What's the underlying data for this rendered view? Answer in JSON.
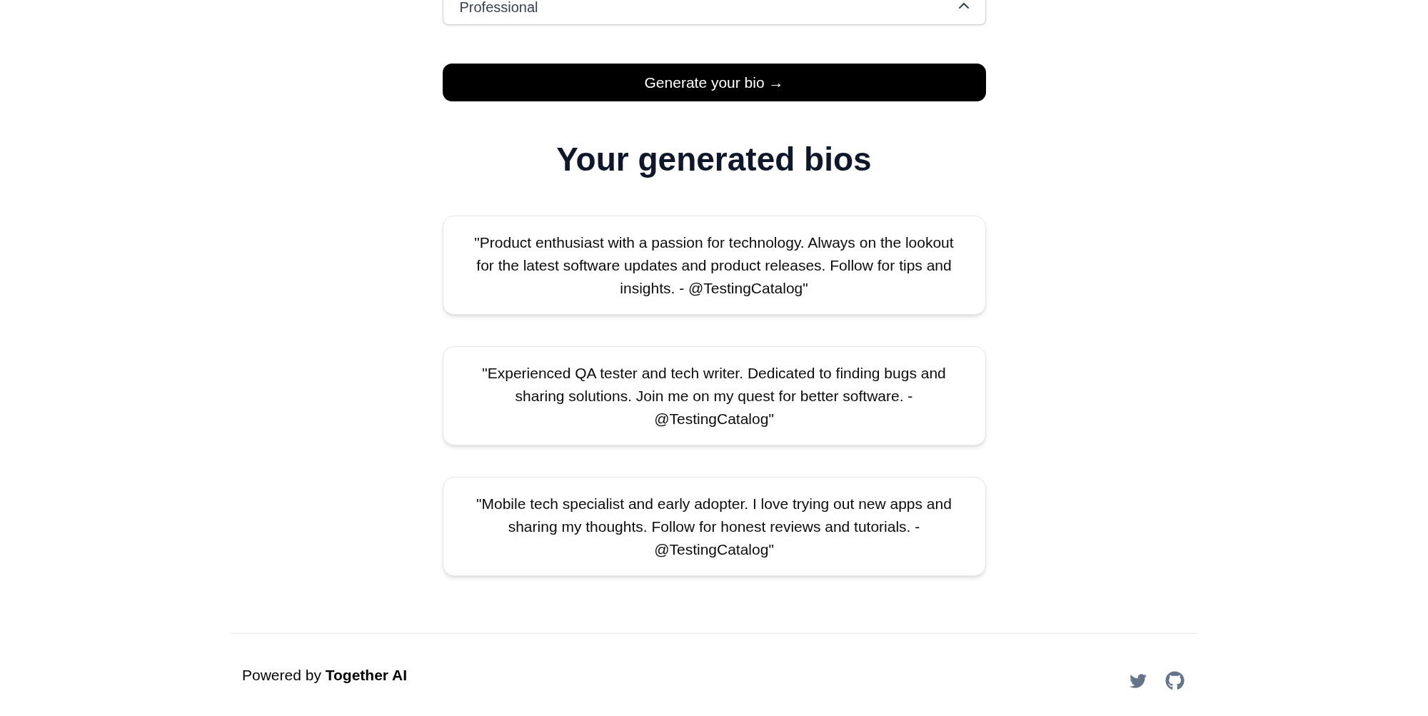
{
  "select": {
    "value": "Professional"
  },
  "generate_button": {
    "label": "Generate your bio →"
  },
  "results": {
    "title": "Your generated bios",
    "bios": [
      "\"Product enthusiast with a passion for technology. Always on the lookout for the latest software updates and product releases. Follow for tips and insights. - @TestingCatalog\"",
      "\"Experienced QA tester and tech writer. Dedicated to finding bugs and sharing solutions. Join me on my quest for better software. - @TestingCatalog\"",
      "\"Mobile tech specialist and early adopter. I love trying out new apps and sharing my thoughts. Follow for honest reviews and tutorials. - @TestingCatalog\""
    ]
  },
  "footer": {
    "credit": "Powered by **Together AI**"
  }
}
